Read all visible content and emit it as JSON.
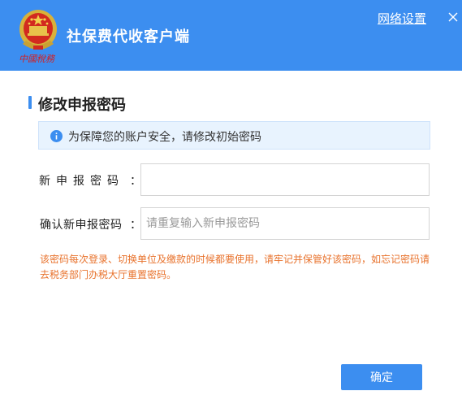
{
  "header": {
    "app_title": "社保费代收客户端",
    "emblem_caption": "中國稅務",
    "network_settings_label": "网络设置",
    "close_icon": "close-icon",
    "emblem_icon": "tax-emblem-icon",
    "background_color": "#3c8ef0"
  },
  "section": {
    "title": "修改申报密码"
  },
  "notice": {
    "icon": "info-icon",
    "text": "为保障您的账户安全，请修改初始密码"
  },
  "form": {
    "new_password_label": "新申报密码",
    "new_password_value": "",
    "new_password_placeholder": "",
    "confirm_password_label": "确认新申报密码",
    "confirm_password_value": "",
    "confirm_password_placeholder": "请重复输入新申报密码",
    "colon": "："
  },
  "warning_text": "该密码每次登录、切换单位及缴款的时候都要使用，请牢记并保管好该密码，如忘记密码请去税务部门办税大厅重置密码。",
  "actions": {
    "confirm_label": "确定"
  },
  "colors": {
    "accent": "#3c8ef0",
    "warning": "#e8722c",
    "notice_bg": "#e8f3fe"
  }
}
